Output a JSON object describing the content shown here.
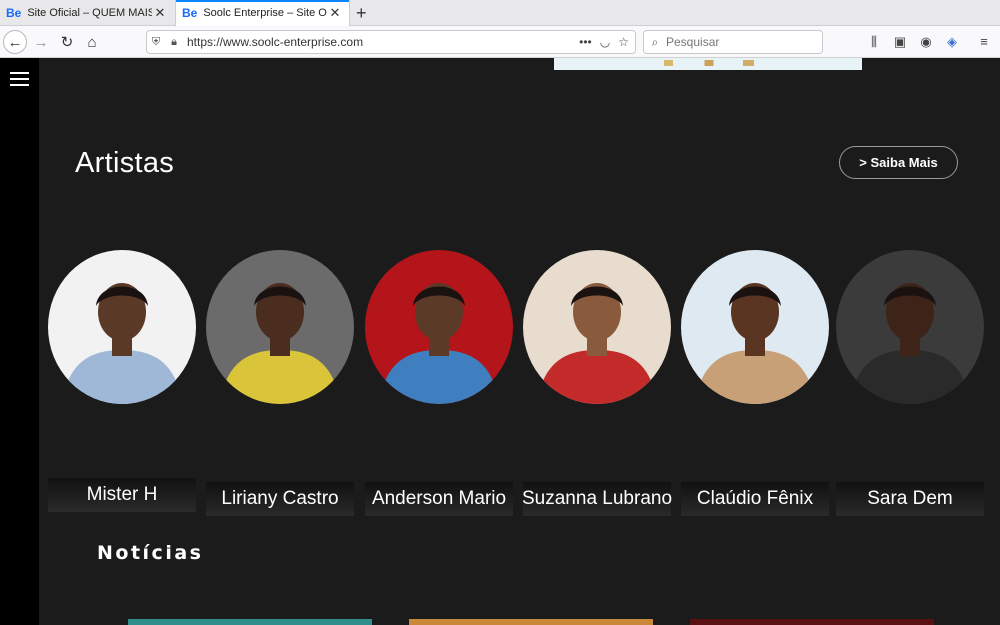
{
  "browser": {
    "tabs": [
      {
        "favicon": "Be",
        "title": "Site Oficial – QUEM MAIS!?",
        "active": false
      },
      {
        "favicon": "Be",
        "title": "Soolc Enterprise – Site Oficial",
        "active": true
      }
    ],
    "url": "https://www.soolc-enterprise.com",
    "search_placeholder": "Pesquisar",
    "icons": {
      "back": "back-arrow-icon",
      "forward": "forward-arrow-icon",
      "reload": "reload-icon",
      "home": "home-icon",
      "shield": "shield-icon",
      "lock": "lock-icon",
      "more": "more-dots-icon",
      "pocket": "pocket-icon",
      "bookmark": "star-icon",
      "library": "library-icon",
      "sidebar": "sidebar-icon",
      "account": "account-icon",
      "extension": "extension-icon",
      "menu": "hamburger-menu-icon"
    }
  },
  "page": {
    "menu_icon": "hamburger-icon",
    "artists_section": {
      "title": "Artistas",
      "more_button": "> Saiba Mais",
      "artists": [
        {
          "name": "Mister H",
          "bg": "#f2f2f2",
          "skin": "#5a3a26",
          "accent": "#9fb8d8"
        },
        {
          "name": "Liriany Castro",
          "bg": "#6b6b6b",
          "skin": "#4a2d1e",
          "accent": "#d9c43a"
        },
        {
          "name": "Anderson Mario",
          "bg": "#b3151a",
          "skin": "#5b3a27",
          "accent": "#3f7fc0"
        },
        {
          "name": "Suzanna Lubrano",
          "bg": "#e7dccd",
          "skin": "#8a5a3c",
          "accent": "#c32a2a"
        },
        {
          "name": "Claúdio Fênix",
          "bg": "#dfe9f1",
          "skin": "#5a3522",
          "accent": "#c8a078"
        },
        {
          "name": "Sara Dem",
          "bg": "#3b3b3b",
          "skin": "#3e2418",
          "accent": "#2a2a2a"
        }
      ]
    },
    "news_section": {
      "title": "Notícias"
    }
  },
  "colors": {
    "page_bg": "#1b1b1b",
    "left_strip": "#000000",
    "active_tab_accent": "#0a84ff"
  }
}
